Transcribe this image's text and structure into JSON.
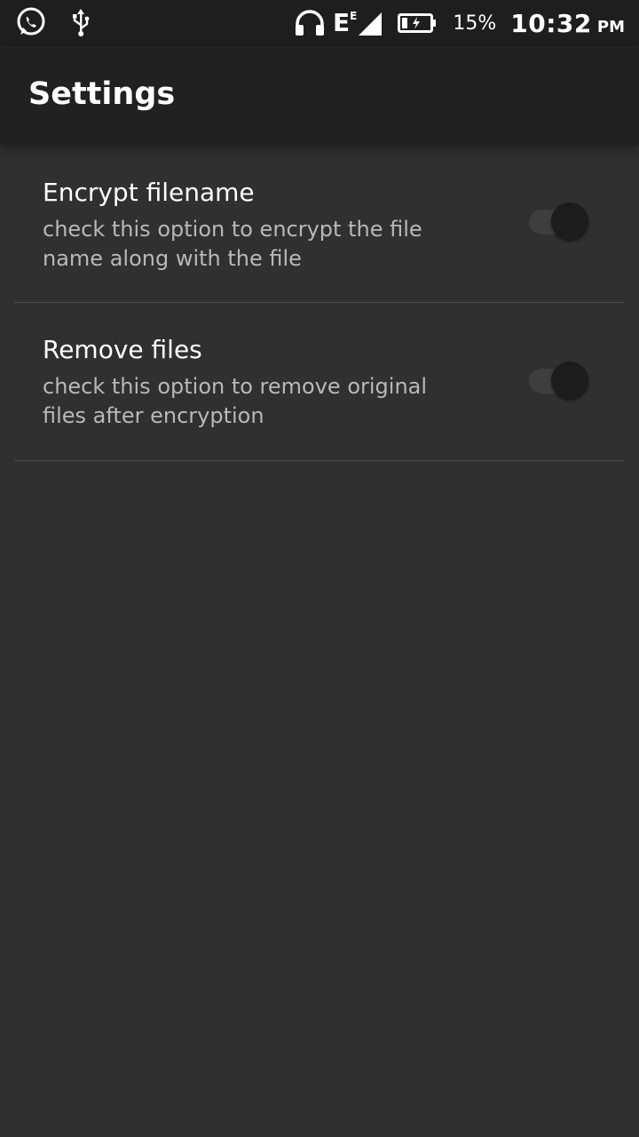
{
  "status_bar": {
    "left_icons": [
      "whatsapp-icon",
      "usb-icon"
    ],
    "right_icons": [
      "headset-icon",
      "network-e-icon",
      "signal-icon",
      "battery-charging-icon"
    ],
    "network_type": "E",
    "battery_percent": "15%",
    "time": "10:32",
    "ampm": "PM"
  },
  "appbar": {
    "title": "Settings"
  },
  "preferences": [
    {
      "title": "Encrypt filename",
      "summary": "check this option to encrypt the file name along with the file",
      "enabled": false
    },
    {
      "title": "Remove files",
      "summary": "check this option to remove original files after encryption",
      "enabled": false
    }
  ],
  "colors": {
    "background": "#303030",
    "appbar": "#212121",
    "statusbar": "#1e1e1e",
    "summary_text": "#b8b8b8"
  }
}
